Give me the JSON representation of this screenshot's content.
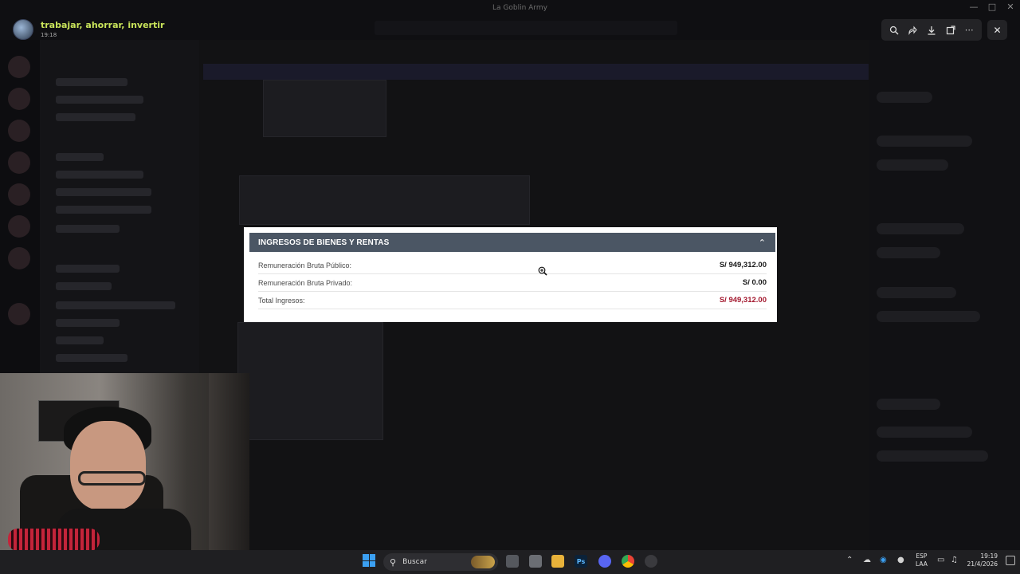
{
  "viewer": {
    "username": "trabajar, ahorrar, invertir",
    "timestamp": "19:18",
    "window_title": "La Goblin Army",
    "tools": [
      "zoom-icon",
      "forward-icon",
      "download-icon",
      "open-external-icon",
      "more-icon"
    ],
    "close": "✕"
  },
  "panel": {
    "title": "INGRESOS DE BIENES Y RENTAS",
    "rows": [
      {
        "label": "Remuneración Bruta Público:",
        "value": "S/ 949,312.00"
      },
      {
        "label": "Remuneración Bruta Privado:",
        "value": "S/ 0.00"
      },
      {
        "label": "Total Ingresos:",
        "value": "S/ 949,312.00"
      }
    ],
    "accent_total": "#a3172d",
    "header_color": "#4b5664"
  },
  "taskbar": {
    "search_placeholder": "Buscar",
    "lang_top": "ESP",
    "lang_bottom": "LAA",
    "time": "19:19",
    "date": "21/4/2026",
    "ps_label": "Ps"
  }
}
